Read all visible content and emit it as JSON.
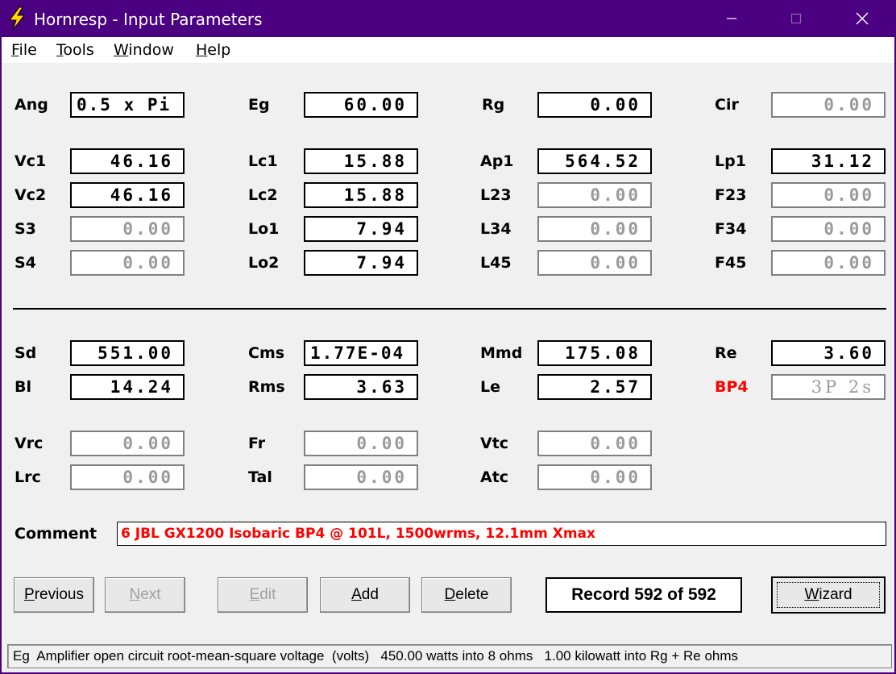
{
  "window": {
    "title": "Hornresp - Input Parameters",
    "icon": "lightning-bolt-icon",
    "controls": [
      "minimize-icon",
      "maximize-icon",
      "close-icon"
    ]
  },
  "menu": {
    "file": {
      "accel": "F",
      "rest": "ile"
    },
    "tools": {
      "accel": "T",
      "rest": "ools"
    },
    "window": {
      "accel": "W",
      "rest": "indow"
    },
    "help": {
      "accel": "H",
      "rest": "elp"
    }
  },
  "params": {
    "ang": {
      "label": "Ang",
      "value": "0.5 x Pi"
    },
    "eg": {
      "label": "Eg",
      "value": "60.00"
    },
    "rg": {
      "label": "Rg",
      "value": "0.00"
    },
    "cir": {
      "label": "Cir",
      "value": "0.00"
    },
    "vc1": {
      "label": "Vc1",
      "value": "46.16"
    },
    "lc1": {
      "label": "Lc1",
      "value": "15.88"
    },
    "ap1": {
      "label": "Ap1",
      "value": "564.52"
    },
    "lp1": {
      "label": "Lp1",
      "value": "31.12"
    },
    "vc2": {
      "label": "Vc2",
      "value": "46.16"
    },
    "lc2": {
      "label": "Lc2",
      "value": "15.88"
    },
    "l23": {
      "label": "L23",
      "value": "0.00"
    },
    "f23": {
      "label": "F23",
      "value": "0.00"
    },
    "s3": {
      "label": "S3",
      "value": "0.00"
    },
    "lo1": {
      "label": "Lo1",
      "value": "7.94"
    },
    "l34": {
      "label": "L34",
      "value": "0.00"
    },
    "f34": {
      "label": "F34",
      "value": "0.00"
    },
    "s4": {
      "label": "S4",
      "value": "0.00"
    },
    "lo2": {
      "label": "Lo2",
      "value": "7.94"
    },
    "l45": {
      "label": "L45",
      "value": "0.00"
    },
    "f45": {
      "label": "F45",
      "value": "0.00"
    },
    "sd": {
      "label": "Sd",
      "value": "551.00"
    },
    "cms": {
      "label": "Cms",
      "value": "1.77E-04"
    },
    "mmd": {
      "label": "Mmd",
      "value": "175.08"
    },
    "re": {
      "label": "Re",
      "value": "3.60"
    },
    "bl": {
      "label": "Bl",
      "value": "14.24"
    },
    "rms": {
      "label": "Rms",
      "value": "3.63"
    },
    "le": {
      "label": "Le",
      "value": "2.57"
    },
    "bp4": {
      "label": "BP4",
      "value": "3P 2s"
    },
    "vrc": {
      "label": "Vrc",
      "value": "0.00"
    },
    "fr": {
      "label": "Fr",
      "value": "0.00"
    },
    "vtc": {
      "label": "Vtc",
      "value": "0.00"
    },
    "lrc": {
      "label": "Lrc",
      "value": "0.00"
    },
    "tal": {
      "label": "Tal",
      "value": "0.00"
    },
    "atc": {
      "label": "Atc",
      "value": "0.00"
    }
  },
  "comment": {
    "label": "Comment",
    "value": "6 JBL GX1200 Isobaric BP4 @ 101L, 1500wrms, 12.1mm Xmax"
  },
  "buttons": {
    "previous": {
      "accel": "P",
      "rest": "revious"
    },
    "next": {
      "accel": "N",
      "rest": "ext"
    },
    "edit": {
      "accel": "E",
      "rest": "dit"
    },
    "add": {
      "accel": "A",
      "rest": "dd"
    },
    "delete": {
      "accel": "D",
      "rest": "elete"
    },
    "wizard": {
      "accel": "W",
      "rest": "izard"
    }
  },
  "record": "Record 592 of 592",
  "status": "Eg  Amplifier open circuit root-mean-square voltage  (volts)   450.00 watts into 8 ohms   1.00 kilowatt into Rg + Re ohms",
  "colors": {
    "titlebar": "#4b0082",
    "accent_red": "#ff0000",
    "panel": "#f0f0f0"
  }
}
